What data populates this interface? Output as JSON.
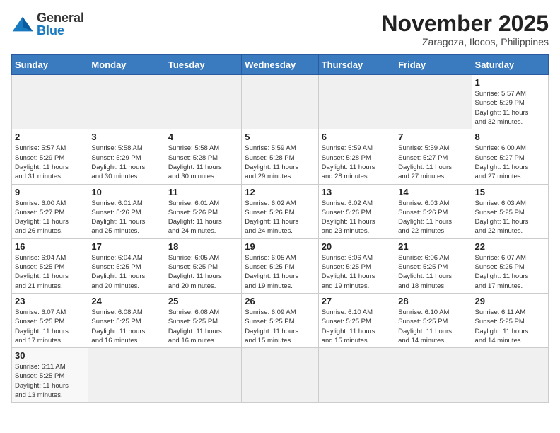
{
  "header": {
    "logo_general": "General",
    "logo_blue": "Blue",
    "month_title": "November 2025",
    "location": "Zaragoza, Ilocos, Philippines"
  },
  "weekdays": [
    "Sunday",
    "Monday",
    "Tuesday",
    "Wednesday",
    "Thursday",
    "Friday",
    "Saturday"
  ],
  "weeks": [
    [
      {
        "day": "",
        "info": ""
      },
      {
        "day": "",
        "info": ""
      },
      {
        "day": "",
        "info": ""
      },
      {
        "day": "",
        "info": ""
      },
      {
        "day": "",
        "info": ""
      },
      {
        "day": "",
        "info": ""
      },
      {
        "day": "1",
        "info": "Sunrise: 5:57 AM\nSunset: 5:29 PM\nDaylight: 11 hours\nand 32 minutes."
      }
    ],
    [
      {
        "day": "2",
        "info": "Sunrise: 5:57 AM\nSunset: 5:29 PM\nDaylight: 11 hours\nand 31 minutes."
      },
      {
        "day": "3",
        "info": "Sunrise: 5:58 AM\nSunset: 5:29 PM\nDaylight: 11 hours\nand 30 minutes."
      },
      {
        "day": "4",
        "info": "Sunrise: 5:58 AM\nSunset: 5:28 PM\nDaylight: 11 hours\nand 30 minutes."
      },
      {
        "day": "5",
        "info": "Sunrise: 5:59 AM\nSunset: 5:28 PM\nDaylight: 11 hours\nand 29 minutes."
      },
      {
        "day": "6",
        "info": "Sunrise: 5:59 AM\nSunset: 5:28 PM\nDaylight: 11 hours\nand 28 minutes."
      },
      {
        "day": "7",
        "info": "Sunrise: 5:59 AM\nSunset: 5:27 PM\nDaylight: 11 hours\nand 27 minutes."
      },
      {
        "day": "8",
        "info": "Sunrise: 6:00 AM\nSunset: 5:27 PM\nDaylight: 11 hours\nand 27 minutes."
      }
    ],
    [
      {
        "day": "9",
        "info": "Sunrise: 6:00 AM\nSunset: 5:27 PM\nDaylight: 11 hours\nand 26 minutes."
      },
      {
        "day": "10",
        "info": "Sunrise: 6:01 AM\nSunset: 5:26 PM\nDaylight: 11 hours\nand 25 minutes."
      },
      {
        "day": "11",
        "info": "Sunrise: 6:01 AM\nSunset: 5:26 PM\nDaylight: 11 hours\nand 24 minutes."
      },
      {
        "day": "12",
        "info": "Sunrise: 6:02 AM\nSunset: 5:26 PM\nDaylight: 11 hours\nand 24 minutes."
      },
      {
        "day": "13",
        "info": "Sunrise: 6:02 AM\nSunset: 5:26 PM\nDaylight: 11 hours\nand 23 minutes."
      },
      {
        "day": "14",
        "info": "Sunrise: 6:03 AM\nSunset: 5:26 PM\nDaylight: 11 hours\nand 22 minutes."
      },
      {
        "day": "15",
        "info": "Sunrise: 6:03 AM\nSunset: 5:25 PM\nDaylight: 11 hours\nand 22 minutes."
      }
    ],
    [
      {
        "day": "16",
        "info": "Sunrise: 6:04 AM\nSunset: 5:25 PM\nDaylight: 11 hours\nand 21 minutes."
      },
      {
        "day": "17",
        "info": "Sunrise: 6:04 AM\nSunset: 5:25 PM\nDaylight: 11 hours\nand 20 minutes."
      },
      {
        "day": "18",
        "info": "Sunrise: 6:05 AM\nSunset: 5:25 PM\nDaylight: 11 hours\nand 20 minutes."
      },
      {
        "day": "19",
        "info": "Sunrise: 6:05 AM\nSunset: 5:25 PM\nDaylight: 11 hours\nand 19 minutes."
      },
      {
        "day": "20",
        "info": "Sunrise: 6:06 AM\nSunset: 5:25 PM\nDaylight: 11 hours\nand 19 minutes."
      },
      {
        "day": "21",
        "info": "Sunrise: 6:06 AM\nSunset: 5:25 PM\nDaylight: 11 hours\nand 18 minutes."
      },
      {
        "day": "22",
        "info": "Sunrise: 6:07 AM\nSunset: 5:25 PM\nDaylight: 11 hours\nand 17 minutes."
      }
    ],
    [
      {
        "day": "23",
        "info": "Sunrise: 6:07 AM\nSunset: 5:25 PM\nDaylight: 11 hours\nand 17 minutes."
      },
      {
        "day": "24",
        "info": "Sunrise: 6:08 AM\nSunset: 5:25 PM\nDaylight: 11 hours\nand 16 minutes."
      },
      {
        "day": "25",
        "info": "Sunrise: 6:08 AM\nSunset: 5:25 PM\nDaylight: 11 hours\nand 16 minutes."
      },
      {
        "day": "26",
        "info": "Sunrise: 6:09 AM\nSunset: 5:25 PM\nDaylight: 11 hours\nand 15 minutes."
      },
      {
        "day": "27",
        "info": "Sunrise: 6:10 AM\nSunset: 5:25 PM\nDaylight: 11 hours\nand 15 minutes."
      },
      {
        "day": "28",
        "info": "Sunrise: 6:10 AM\nSunset: 5:25 PM\nDaylight: 11 hours\nand 14 minutes."
      },
      {
        "day": "29",
        "info": "Sunrise: 6:11 AM\nSunset: 5:25 PM\nDaylight: 11 hours\nand 14 minutes."
      }
    ],
    [
      {
        "day": "30",
        "info": "Sunrise: 6:11 AM\nSunset: 5:25 PM\nDaylight: 11 hours\nand 13 minutes."
      },
      {
        "day": "",
        "info": ""
      },
      {
        "day": "",
        "info": ""
      },
      {
        "day": "",
        "info": ""
      },
      {
        "day": "",
        "info": ""
      },
      {
        "day": "",
        "info": ""
      },
      {
        "day": "",
        "info": ""
      }
    ]
  ]
}
